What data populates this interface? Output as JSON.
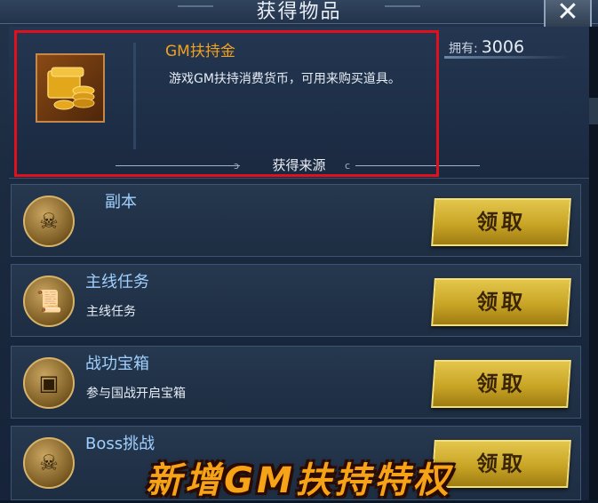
{
  "window": {
    "title": "获得物品",
    "close_label": "✕"
  },
  "item": {
    "name": "GM扶持金",
    "description": "游戏GM扶持消费货币，可用来购买道具。",
    "owned_label": "拥有:",
    "owned_count": "3006",
    "icon": "gold-coins-icon"
  },
  "source": {
    "title": "获得来源"
  },
  "sources": [
    {
      "title": "副本",
      "subtitle": "",
      "button": "领取",
      "icon": "skull-emblem-icon"
    },
    {
      "title": "主线任务",
      "subtitle": "主线任务",
      "button": "领取",
      "icon": "scroll-icon"
    },
    {
      "title": "战功宝箱",
      "subtitle": "参与国战开启宝箱",
      "button": "领取",
      "icon": "chest-icon"
    },
    {
      "title": "Boss挑战",
      "subtitle": "",
      "button": "领取",
      "icon": "pirate-skull-icon"
    }
  ],
  "overlay": {
    "banner": "新增GM扶持特权"
  },
  "colors": {
    "item_name": "#f0a21e",
    "source_title": "#9fd0ff",
    "claim_button": "#d8b93a",
    "highlight_box": "#e0101c",
    "banner": "#f6a317"
  }
}
